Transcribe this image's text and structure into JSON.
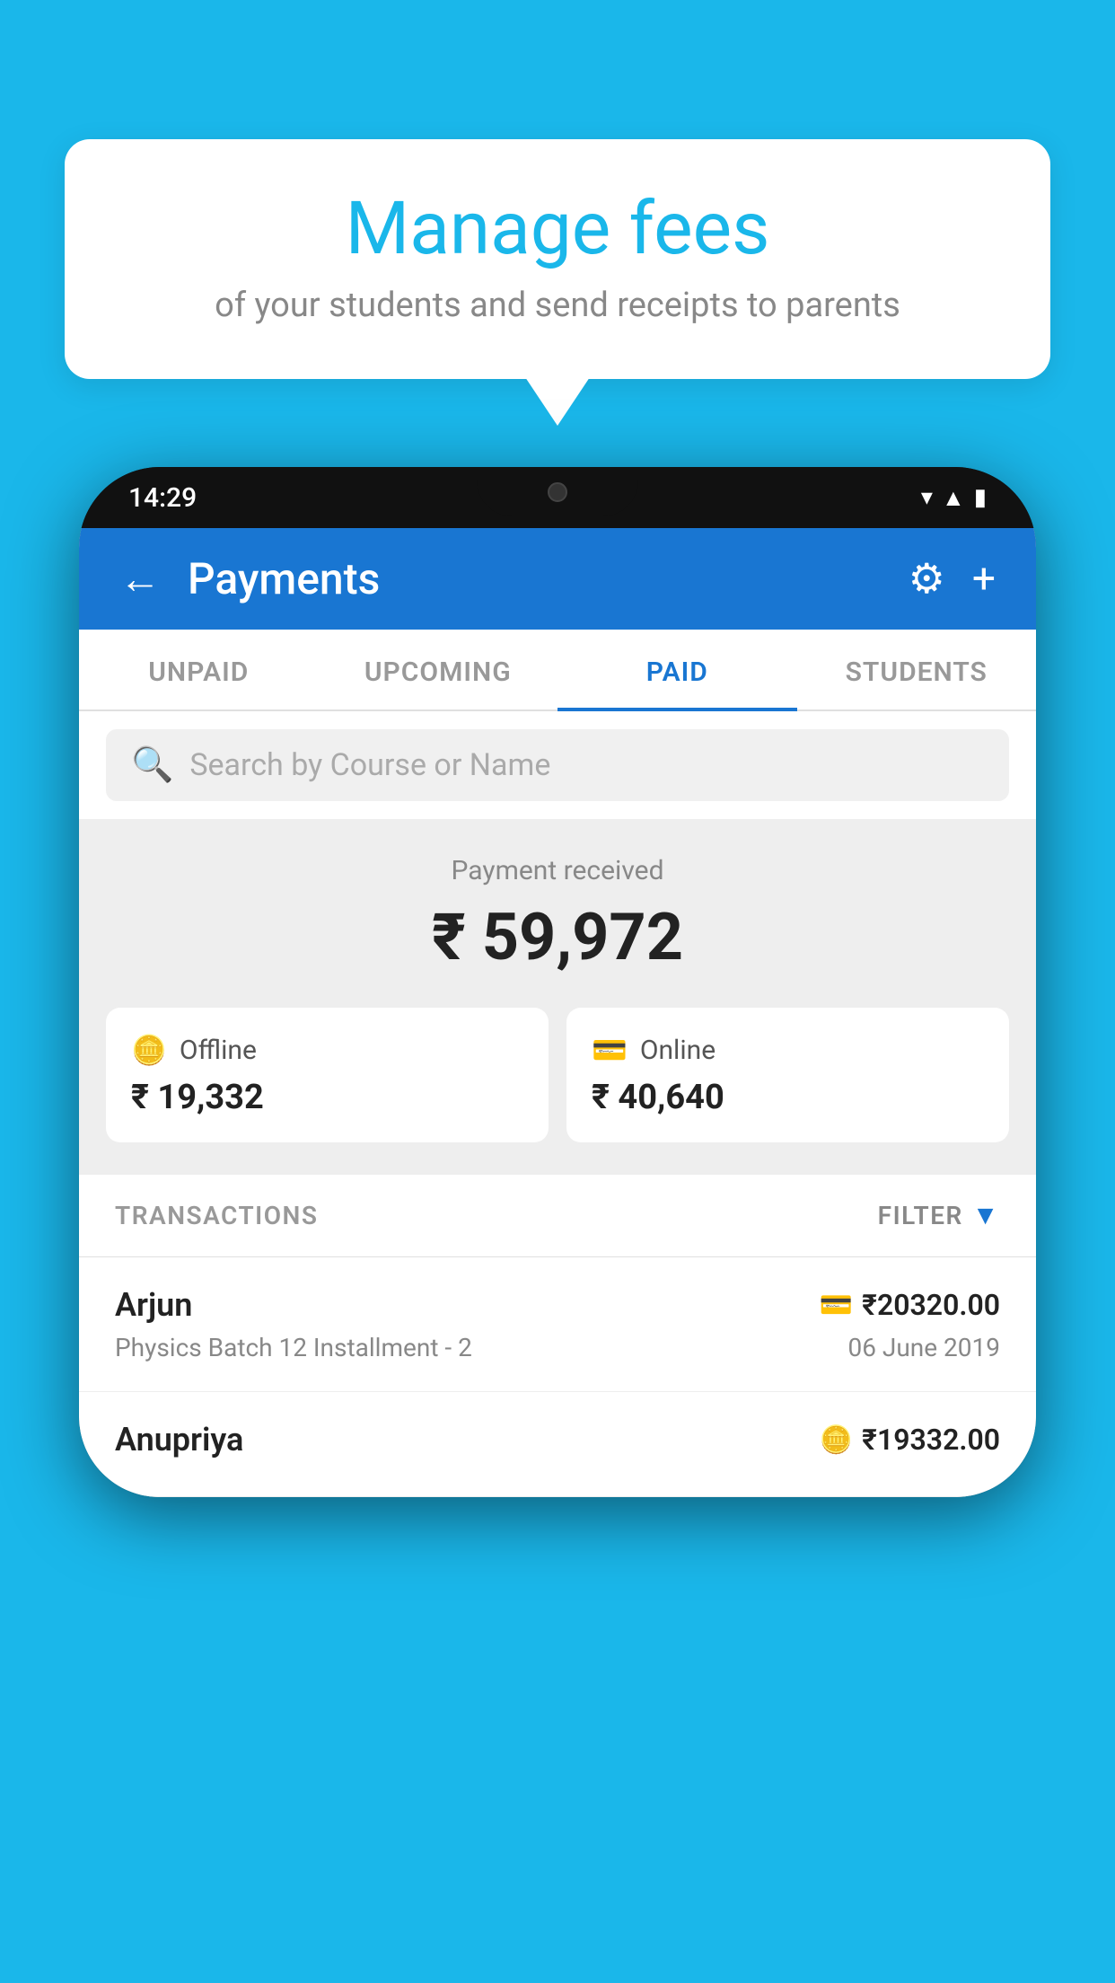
{
  "background_color": "#1ab7ea",
  "bubble": {
    "title": "Manage fees",
    "subtitle": "of your students and send receipts to parents"
  },
  "phone": {
    "time": "14:29",
    "header": {
      "back_label": "←",
      "title": "Payments",
      "settings_icon": "⚙",
      "add_icon": "+"
    },
    "tabs": [
      {
        "label": "UNPAID",
        "active": false
      },
      {
        "label": "UPCOMING",
        "active": false
      },
      {
        "label": "PAID",
        "active": true
      },
      {
        "label": "STUDENTS",
        "active": false
      }
    ],
    "search": {
      "placeholder": "Search by Course or Name"
    },
    "payment_received": {
      "label": "Payment received",
      "amount": "₹ 59,972",
      "offline_label": "Offline",
      "offline_amount": "₹ 19,332",
      "online_label": "Online",
      "online_amount": "₹ 40,640"
    },
    "transactions": {
      "header_label": "TRANSACTIONS",
      "filter_label": "FILTER",
      "rows": [
        {
          "name": "Arjun",
          "course": "Physics Batch 12 Installment - 2",
          "amount": "₹20320.00",
          "date": "06 June 2019",
          "type_icon": "💳"
        },
        {
          "name": "Anupriya",
          "course": "",
          "amount": "₹19332.00",
          "date": "",
          "type_icon": "🪙"
        }
      ]
    }
  }
}
